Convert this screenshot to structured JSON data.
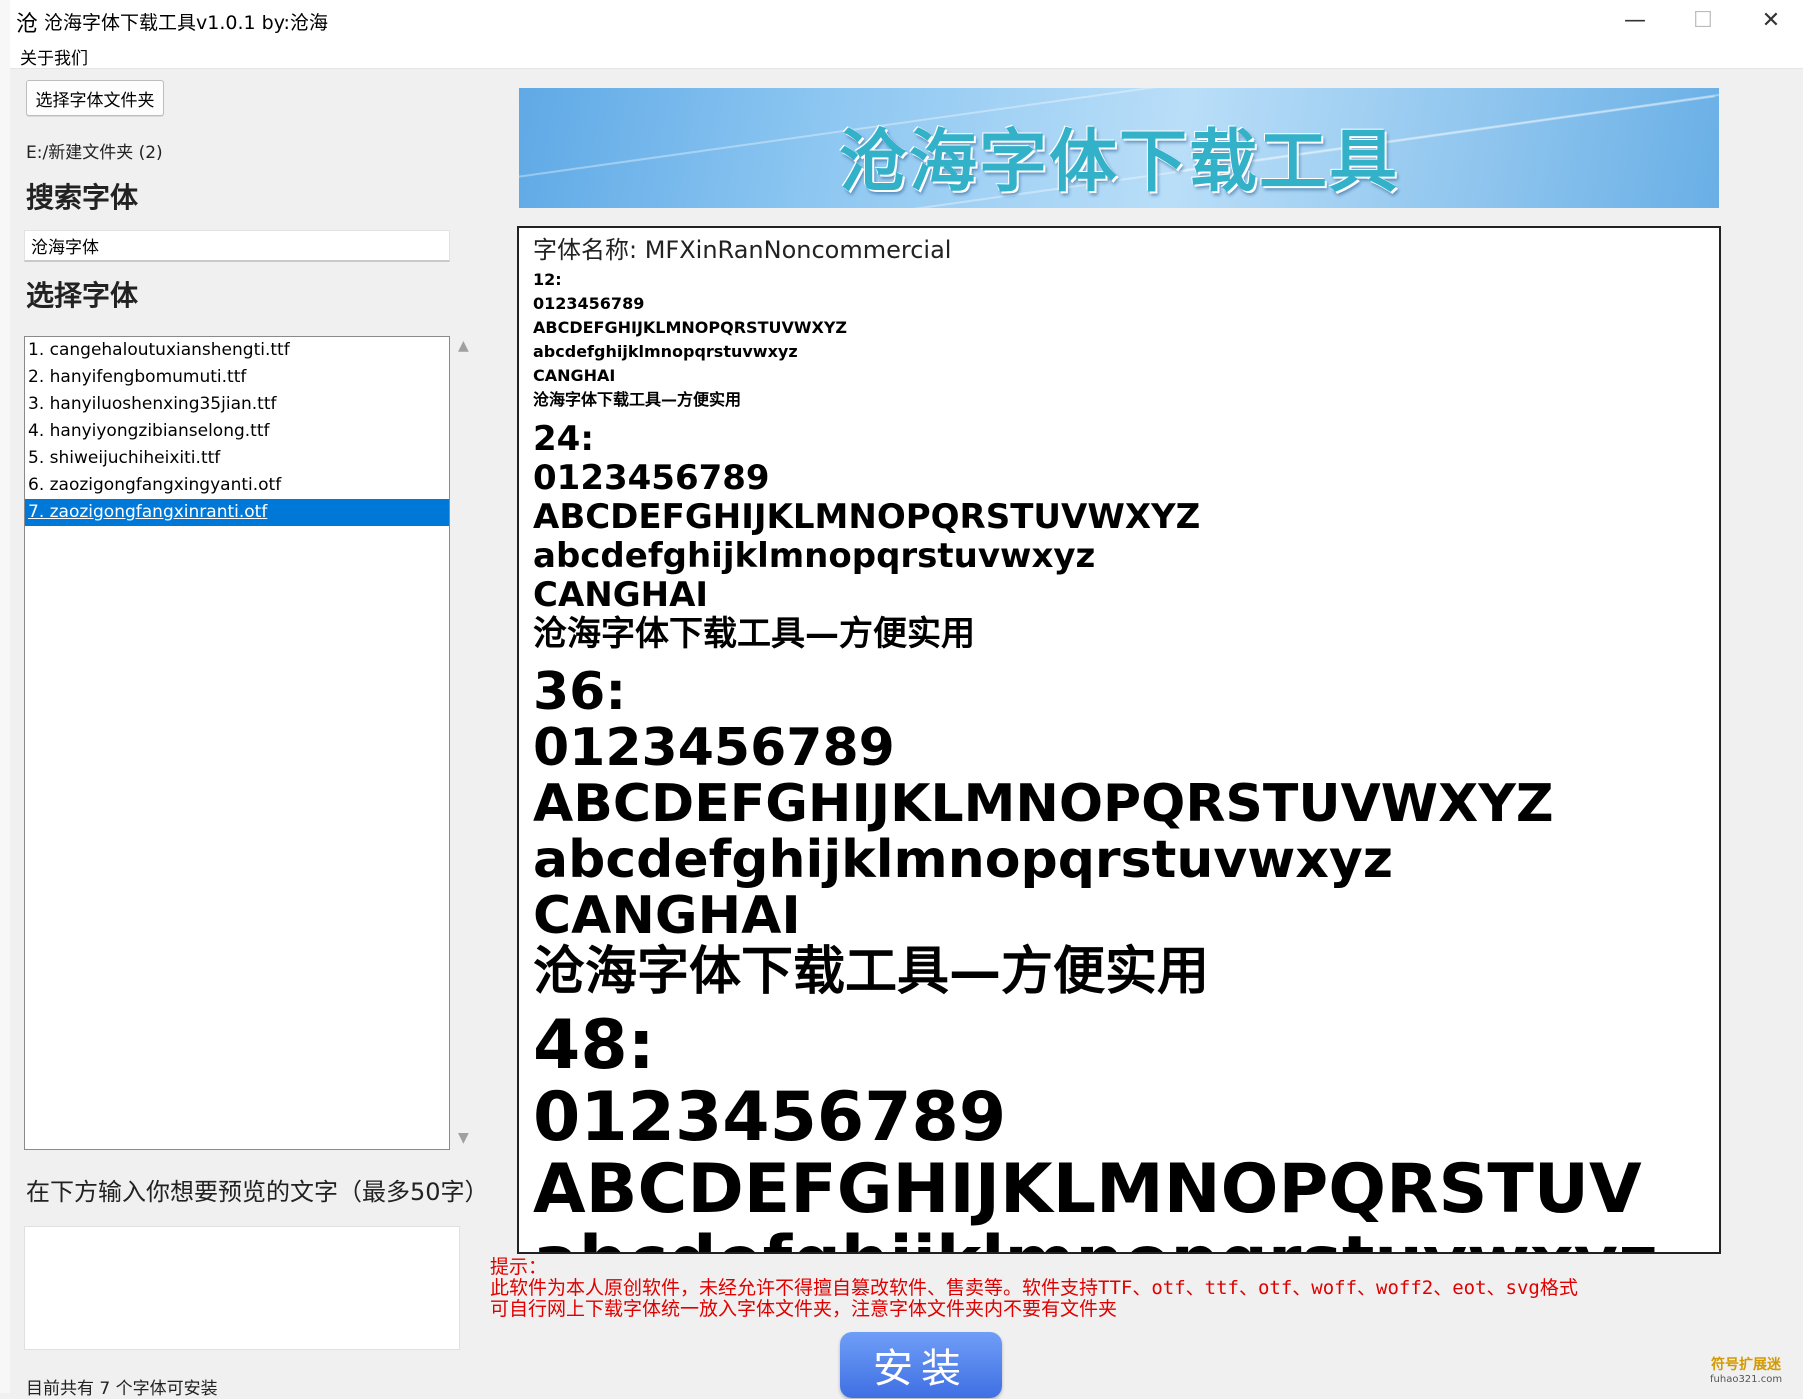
{
  "window": {
    "app_icon": "沧",
    "title": "沧海字体下载工具v1.0.1 by:沧海",
    "min_glyph": "—",
    "max_glyph": "☐",
    "close_glyph": "✕"
  },
  "menu": {
    "about": "关于我们"
  },
  "left": {
    "choose_folder_button": "选择字体文件夹",
    "folder_path": "E:/新建文件夹 (2)",
    "search_heading": "搜索字体",
    "search_value": "沧海字体",
    "select_heading": "选择字体",
    "fonts": [
      "1. cangehaloutuxianshengti.ttf",
      "2. hanyifengbomumuti.ttf",
      "3. hanyiluoshenxing35jian.ttf",
      "4. hanyiyongzibianselong.ttf",
      "5. shiweijuchiheixiti.ttf",
      "6. zaozigongfangxingyanti.otf",
      "7. zaozigongfangxinranti.otf"
    ],
    "selected_index": 6,
    "scroll_up_glyph": "▲",
    "scroll_down_glyph": "▼",
    "preview_label": "在下方输入你想要预览的文字（最多50字）",
    "preview_input_value": "",
    "status": "目前共有 7 个字体可安装"
  },
  "banner": {
    "title": "沧海字体下载工具"
  },
  "preview": {
    "font_name": "字体名称: MFXinRanNoncommercial",
    "samples": [
      {
        "size_label": "12:",
        "digits": "0123456789",
        "upper": "ABCDEFGHIJKLMNOPQRSTUVWXYZ",
        "lower": "abcdefghijklmnopqrstuvwxyz",
        "name": "CANGHAI",
        "chinese": "沧海字体下载工具—方便实用"
      },
      {
        "size_label": "24:",
        "digits": "0123456789",
        "upper": "ABCDEFGHIJKLMNOPQRSTUVWXYZ",
        "lower": "abcdefghijklmnopqrstuvwxyz",
        "name": "CANGHAI",
        "chinese": "沧海字体下载工具—方便实用"
      },
      {
        "size_label": "36:",
        "digits": "0123456789",
        "upper": "ABCDEFGHIJKLMNOPQRSTUVWXYZ",
        "lower": "abcdefghijklmnopqrstuvwxyz",
        "name": "CANGHAI",
        "chinese": "沧海字体下载工具—方便实用"
      },
      {
        "size_label": "48:",
        "digits": "0123456789",
        "upper": "ABCDEFGHIJKLMNOPQRSTUV",
        "lower": "abcdefghijklmnopqrstuvwxyz"
      }
    ]
  },
  "notice": {
    "line1": "提示：",
    "line2": "此软件为本人原创软件，未经允许不得擅自篡改软件、售卖等。软件支持TTF、otf、ttf、otf、woff、woff2、eot、svg格式",
    "line3": "可自行网上下载字体统一放入字体文件夹，注意字体文件夹内不要有文件夹"
  },
  "install_button": "安装",
  "watermark": {
    "main": "符号扩展迷",
    "sub": "fuhao321.com"
  },
  "colors": {
    "selection": "#0078d7",
    "notice": "#e00000",
    "install_button": "#4f7fea"
  }
}
